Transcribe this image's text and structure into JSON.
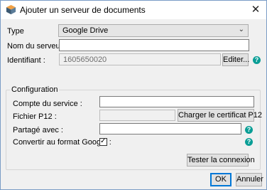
{
  "window": {
    "title": "Ajouter un serveur de documents",
    "close_glyph": "✕"
  },
  "form": {
    "type_label": "Type",
    "type_value": "Google Drive",
    "type_chevron": "⌄",
    "server_name_label": "Nom du serveur :",
    "server_name_value": "",
    "identifier_label": "Identifiant :",
    "identifier_value": "1605650020",
    "edit_button": "Editer..."
  },
  "configuration": {
    "group_label": "Configuration",
    "service_account_label": "Compte du service :",
    "service_account_value": "",
    "p12_file_label": "Fichier P12 :",
    "p12_file_value": "",
    "load_certificate_button": "Charger le certificat P12",
    "shared_with_label": "Partagé avec :",
    "shared_with_value": "",
    "convert_label": "Convertir au format Google :",
    "convert_checked": true,
    "check_glyph": "✓",
    "test_connection_button": "Tester la connexion"
  },
  "footer": {
    "ok_button": "OK",
    "cancel_button": "Annuler"
  },
  "help_glyph": "?",
  "colors": {
    "help_icon": "#0a9e96",
    "default_button_border": "#0078d7"
  }
}
